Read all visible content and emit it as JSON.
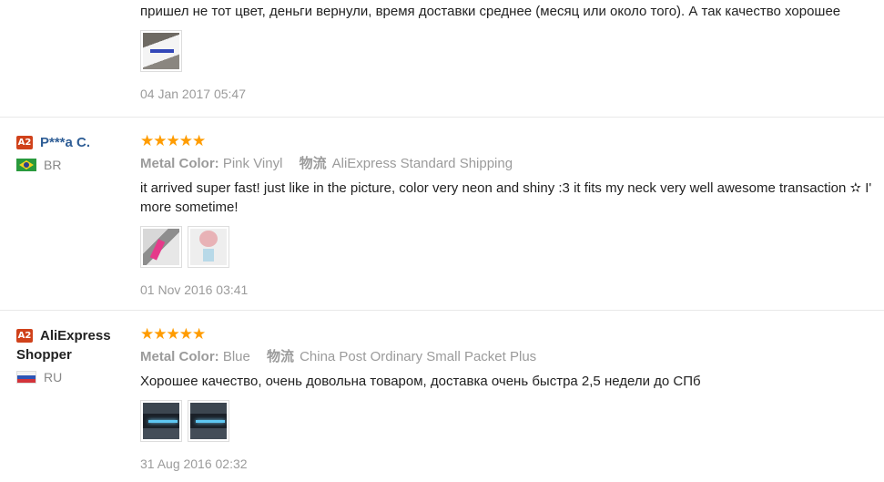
{
  "reviews": [
    {
      "text": "пришел не тот цвет, деньги вернули, время доставки среднее (месяц или около того). А так качество хорошее",
      "images": [
        "review-photo"
      ],
      "date": "04 Jan 2017 05:47"
    },
    {
      "badge": "A2",
      "name": "P***a C.",
      "country": "BR",
      "stars": "★★★★★",
      "rating": 5,
      "color_label": "Metal Color:",
      "color_value": "Pink Vinyl",
      "shipping_label": "物流",
      "shipping_value": "AliExpress Standard Shipping",
      "text": "it arrived super fast! just like in the picture, color very neon and shiny :3 it fits my neck very well awesome transaction ✫ I'\nmore sometime!",
      "images": [
        "review-photo",
        "review-photo"
      ],
      "date": "01 Nov 2016 03:41"
    },
    {
      "badge": "A2",
      "name": "AliExpress Shopper",
      "country": "RU",
      "stars": "★★★★★",
      "rating": 5,
      "color_label": "Metal Color:",
      "color_value": "Blue",
      "shipping_label": "物流",
      "shipping_value": "China Post Ordinary Small Packet Plus",
      "text": "Хорошее качество, очень довольна товаром, доставка очень быстра 2,5 недели до СПб",
      "images": [
        "review-photo",
        "review-photo"
      ],
      "date": "31 Aug 2016 02:32"
    }
  ],
  "colors": {
    "star": "#ff9c00",
    "badge": "#d0421b",
    "muted": "#9b9b9b"
  }
}
